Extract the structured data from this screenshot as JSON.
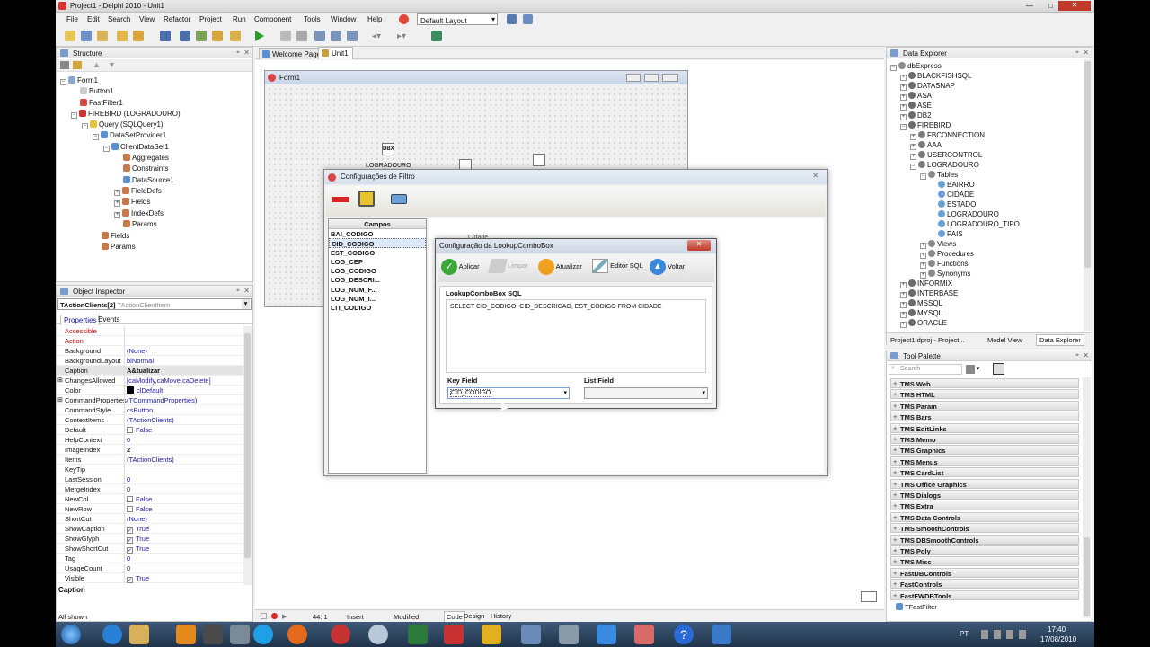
{
  "window": {
    "title": "Project1 - Delphi 2010 - Unit1"
  },
  "menu": [
    "File",
    "Edit",
    "Search",
    "View",
    "Refactor",
    "Project",
    "Run",
    "Component",
    "Tools",
    "Window",
    "Help"
  ],
  "layout_select": "Default Layout",
  "structure": {
    "title": "Structure",
    "items": [
      "Form1",
      "Button1",
      "FastFilter1",
      "FIREBIRD (LOGRADOURO)",
      "Query (SQLQuery1)",
      "DataSetProvider1",
      "ClientDataSet1",
      "Aggregates",
      "Constraints",
      "DataSource1",
      "FieldDefs",
      "Fields",
      "IndexDefs",
      "Params",
      "Fields",
      "Params"
    ]
  },
  "object_inspector": {
    "title": "Object Inspector",
    "selected": "TActionClients[2]",
    "selected_type": "TActionClientItem",
    "tabs": [
      "Properties",
      "Events"
    ],
    "rows": [
      {
        "n": "Accessible",
        "v": "",
        "red": true
      },
      {
        "n": "Action",
        "v": "",
        "red": true
      },
      {
        "n": "Background",
        "v": "(None)"
      },
      {
        "n": "BackgroundLayout",
        "v": "blNormal"
      },
      {
        "n": "Caption",
        "v": "A&tualizar",
        "bold": true,
        "sel": true
      },
      {
        "n": "ChangesAllowed",
        "v": "[caModify,caMove,caDelete]",
        "exp": true
      },
      {
        "n": "Color",
        "v": "clDefault",
        "sw": true
      },
      {
        "n": "CommandProperties",
        "v": "(TCommandProperties)",
        "exp": true
      },
      {
        "n": "CommandStyle",
        "v": "csButton"
      },
      {
        "n": "ContextItems",
        "v": "(TActionClients)"
      },
      {
        "n": "Default",
        "v": "False",
        "cb": true
      },
      {
        "n": "HelpContext",
        "v": "0"
      },
      {
        "n": "ImageIndex",
        "v": "2",
        "bold": true
      },
      {
        "n": "Items",
        "v": "(TActionClients)"
      },
      {
        "n": "KeyTip",
        "v": ""
      },
      {
        "n": "LastSession",
        "v": "0"
      },
      {
        "n": "MergeIndex",
        "v": "0"
      },
      {
        "n": "NewCol",
        "v": "False",
        "cb": true
      },
      {
        "n": "NewRow",
        "v": "False",
        "cb": true
      },
      {
        "n": "ShortCut",
        "v": "(None)"
      },
      {
        "n": "ShowCaption",
        "v": "True",
        "cb": true,
        "chk": true
      },
      {
        "n": "ShowGlyph",
        "v": "True",
        "cb": true,
        "chk": true
      },
      {
        "n": "ShowShortCut",
        "v": "True",
        "cb": true,
        "chk": true
      },
      {
        "n": "Tag",
        "v": "0"
      },
      {
        "n": "UsageCount",
        "v": "0"
      },
      {
        "n": "Visible",
        "v": "True",
        "cb": true,
        "chk": true
      }
    ],
    "footer": "Caption",
    "status": "All shown"
  },
  "editor": {
    "tabs": [
      "Welcome Page",
      "Unit1"
    ],
    "form_title": "Form1",
    "comp_label": "LOGRADOURO",
    "bottom_tabs": [
      "Code",
      "Design",
      "History"
    ],
    "status_pos": "44:  1",
    "status_mode": "Insert",
    "status_mod": "Modified"
  },
  "filtro": {
    "title": "Configurações de Filtro",
    "campos_header": "Campos",
    "campos": [
      "BAI_CODIGO",
      "CID_CODIGO",
      "EST_CODIGO",
      "LOG_CEP",
      "LOG_CODIGO",
      "LOG_DESCRI...",
      "LOG_NUM_F...",
      "LOG_NUM_I...",
      "LTI_CODIGO"
    ]
  },
  "lookup": {
    "title": "Configuração da LookupComboBox",
    "buttons": [
      "Aplicar",
      "Limpar",
      "Atualizar",
      "Editor SQL",
      "Voltar"
    ],
    "sql_label": "LookupComboBox SQL",
    "sql": "SELECT CID_CODIGO, CID_DESCRICAO, EST_CODIGO FROM CIDADE",
    "key_label": "Key Field",
    "key_value": "CID_CODIGO",
    "list_label": "List Field",
    "list_value": ""
  },
  "data_explorer": {
    "title": "Data Explorer",
    "items": [
      "dbExpress",
      "BLACKFISHSQL",
      "DATASNAP",
      "ASA",
      "ASE",
      "DB2",
      "FIREBIRD",
      "FBCONNECTION",
      "AAA",
      "USERCONTROL",
      "LOGRADOURO",
      "Tables",
      "BAIRRO",
      "CIDADE",
      "ESTADO",
      "LOGRADOURO",
      "LOGRADOURO_TIPO",
      "PAIS",
      "Views",
      "Procedures",
      "Functions",
      "Synonyms",
      "INFORMIX",
      "INTERBASE",
      "MSSQL",
      "MYSQL",
      "ORACLE"
    ],
    "tabs": [
      "Project1.dproj - Project...",
      "Model View",
      "Data Explorer"
    ]
  },
  "tool_palette": {
    "title": "Tool Palette",
    "search": "Search",
    "groups": [
      "TMS Web",
      "TMS HTML",
      "TMS Param",
      "TMS Bars",
      "TMS EditLinks",
      "TMS Memo",
      "TMS Graphics",
      "TMS Menus",
      "TMS CardList",
      "TMS Office Graphics",
      "TMS Dialogs",
      "TMS Extra",
      "TMS Data Controls",
      "TMS SmoothControls",
      "TMS DBSmoothControls",
      "TMS Poly",
      "TMS Misc",
      "FastDBControls",
      "FastControls",
      "FastFWDBTools"
    ],
    "item": "TFastFilter"
  },
  "taskbar": {
    "lang": "PT",
    "time": "17:40",
    "date": "17/08/2010"
  }
}
